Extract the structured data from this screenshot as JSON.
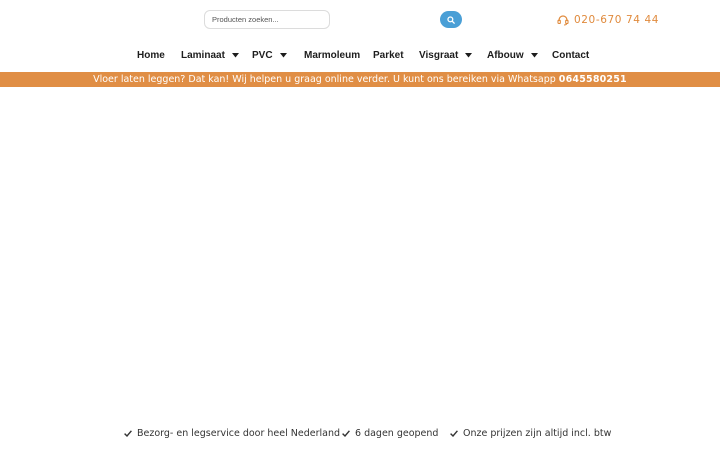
{
  "header": {
    "search": {
      "placeholder": "Producten zoeken...",
      "value": "",
      "button_icon": "search-icon"
    },
    "phone": {
      "icon": "headset-icon",
      "number": "020-670 74 44"
    }
  },
  "nav": {
    "items": [
      {
        "label": "Home",
        "dropdown": false
      },
      {
        "label": "Laminaat",
        "dropdown": true
      },
      {
        "label": "PVC",
        "dropdown": true
      },
      {
        "label": "Marmoleum",
        "dropdown": false
      },
      {
        "label": "Parket",
        "dropdown": false
      },
      {
        "label": "Visgraat",
        "dropdown": true
      },
      {
        "label": "Afbouw",
        "dropdown": true
      },
      {
        "label": "Contact",
        "dropdown": false
      }
    ]
  },
  "banner": {
    "text": "Vloer laten leggen? Dat kan! Wij helpen u graag online verder. U kunt ons bereiken via Whatsapp",
    "whatsapp_number": "0645580251"
  },
  "usps": [
    {
      "icon": "checkmark-icon",
      "text": "Bezorg- en legservice door heel Nederland"
    },
    {
      "icon": "checkmark-icon",
      "text": "6 dagen geopend"
    },
    {
      "icon": "checkmark-icon",
      "text": "Onze prijzen zijn altijd incl. btw"
    }
  ],
  "colors": {
    "accent": "#e08e45",
    "search_button": "#4a9fd6",
    "phone_text": "#e08a3c"
  }
}
